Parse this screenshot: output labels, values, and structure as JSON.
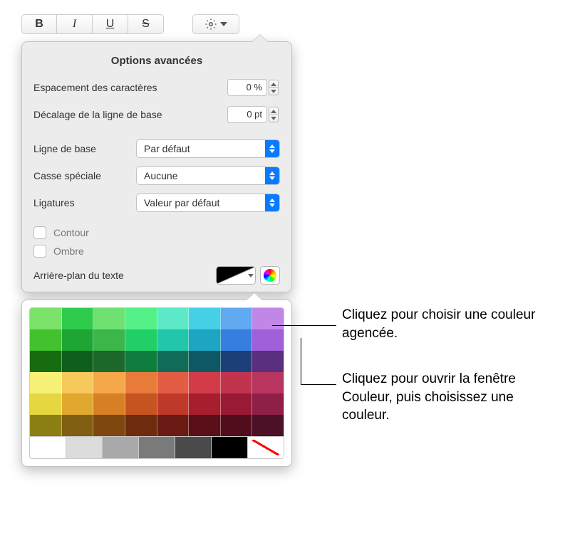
{
  "toolbar": {
    "bold": "B",
    "italic": "I",
    "underline": "U",
    "strike": "S"
  },
  "panel": {
    "title": "Options avancées",
    "char_spacing_label": "Espacement des caractères",
    "char_spacing_value": "0 %",
    "baseline_shift_label": "Décalage de la ligne de base",
    "baseline_shift_value": "0 pt",
    "baseline_label": "Ligne de base",
    "baseline_value": "Par défaut",
    "caps_label": "Casse spéciale",
    "caps_value": "Aucune",
    "ligatures_label": "Ligatures",
    "ligatures_value": "Valeur par défaut",
    "outline_label": "Contour",
    "shadow_label": "Ombre",
    "text_bg_label": "Arrière-plan du texte"
  },
  "swatches": {
    "rows": [
      [
        "#7CE36A",
        "#2FCB4C",
        "#6FE072",
        "#53F087",
        "#5DE9C8",
        "#45D0E8",
        "#60A8F0",
        "#C087E8"
      ],
      [
        "#43C12E",
        "#1EA634",
        "#3BB649",
        "#20CF68",
        "#22C6AA",
        "#1CA6C3",
        "#367FE0",
        "#A060DA"
      ],
      [
        "#166C0F",
        "#0E5F1D",
        "#1C672A",
        "#0F7D3E",
        "#106B59",
        "#0E5866",
        "#1C3F7A",
        "#5A2F7F"
      ],
      [
        "#F8F178",
        "#F6C95A",
        "#F4A84A",
        "#E97B3A",
        "#E35C44",
        "#D23C49",
        "#C2334D",
        "#B93660"
      ],
      [
        "#E6D740",
        "#E0A82E",
        "#D77F24",
        "#C65420",
        "#BF392A",
        "#A81E2E",
        "#981A35",
        "#8F1F47"
      ],
      [
        "#8C7F14",
        "#825E12",
        "#7D470F",
        "#6E2B0E",
        "#6B1B14",
        "#5B0F18",
        "#520D1D",
        "#4C1027"
      ]
    ],
    "final": [
      "#FFFFFF",
      "#DCDCDC",
      "#A9A9A9",
      "#7A7A7A",
      "#4A4A4A",
      "#000000"
    ]
  },
  "annotations": {
    "matched": "Cliquez pour choisir une couleur agencée.",
    "picker": "Cliquez pour ouvrir la fenêtre Couleur, puis choisissez une couleur."
  }
}
